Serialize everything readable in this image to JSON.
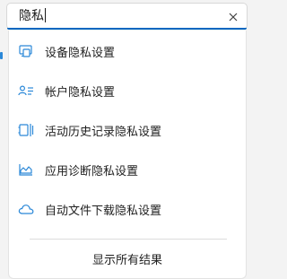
{
  "search": {
    "query": "隐私",
    "clear_icon": "close-icon"
  },
  "results": [
    {
      "label": "设备隐私设置",
      "icon": "device-icon"
    },
    {
      "label": "帐户隐私设置",
      "icon": "account-icon"
    },
    {
      "label": "活动历史记录隐私设置",
      "icon": "activity-history-icon"
    },
    {
      "label": "应用诊断隐私设置",
      "icon": "app-diagnostics-icon"
    },
    {
      "label": "自动文件下载隐私设置",
      "icon": "cloud-icon"
    }
  ],
  "show_all_label": "显示所有结果",
  "colors": {
    "accent": "#0067c0",
    "icon": "#2b88d8"
  }
}
